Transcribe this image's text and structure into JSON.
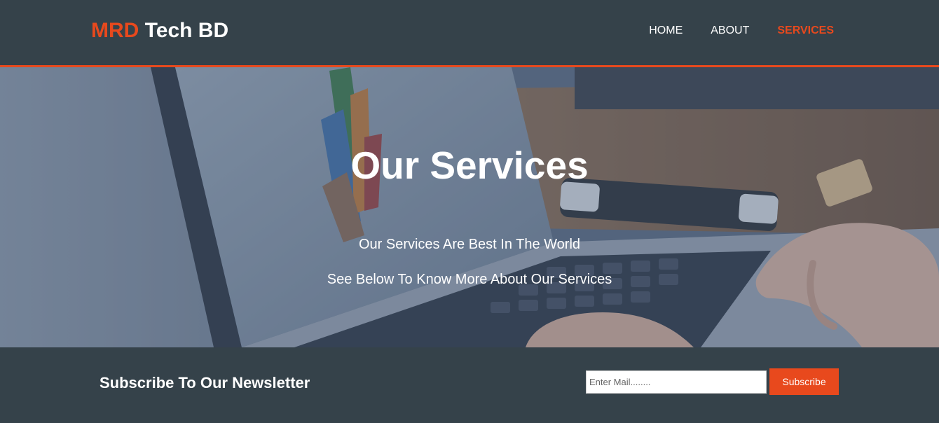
{
  "header": {
    "brand_highlight": "MRD",
    "brand_rest": " Tech BD",
    "nav": [
      {
        "label": "HOME",
        "current": false
      },
      {
        "label": "ABOUT",
        "current": false
      },
      {
        "label": "SERVICES",
        "current": true
      }
    ]
  },
  "showcase": {
    "title": "Our Services",
    "line1": "Our Services Are Best In The World",
    "line2": "See Below To Know More About Our Services"
  },
  "newsletter": {
    "title": "Subscribe To Our Newsletter",
    "input_placeholder": "Enter Mail........",
    "input_value": "",
    "button_label": "Subscribe"
  },
  "colors": {
    "dark": "#35424a",
    "accent": "#e8491d",
    "text": "#ffffff"
  }
}
